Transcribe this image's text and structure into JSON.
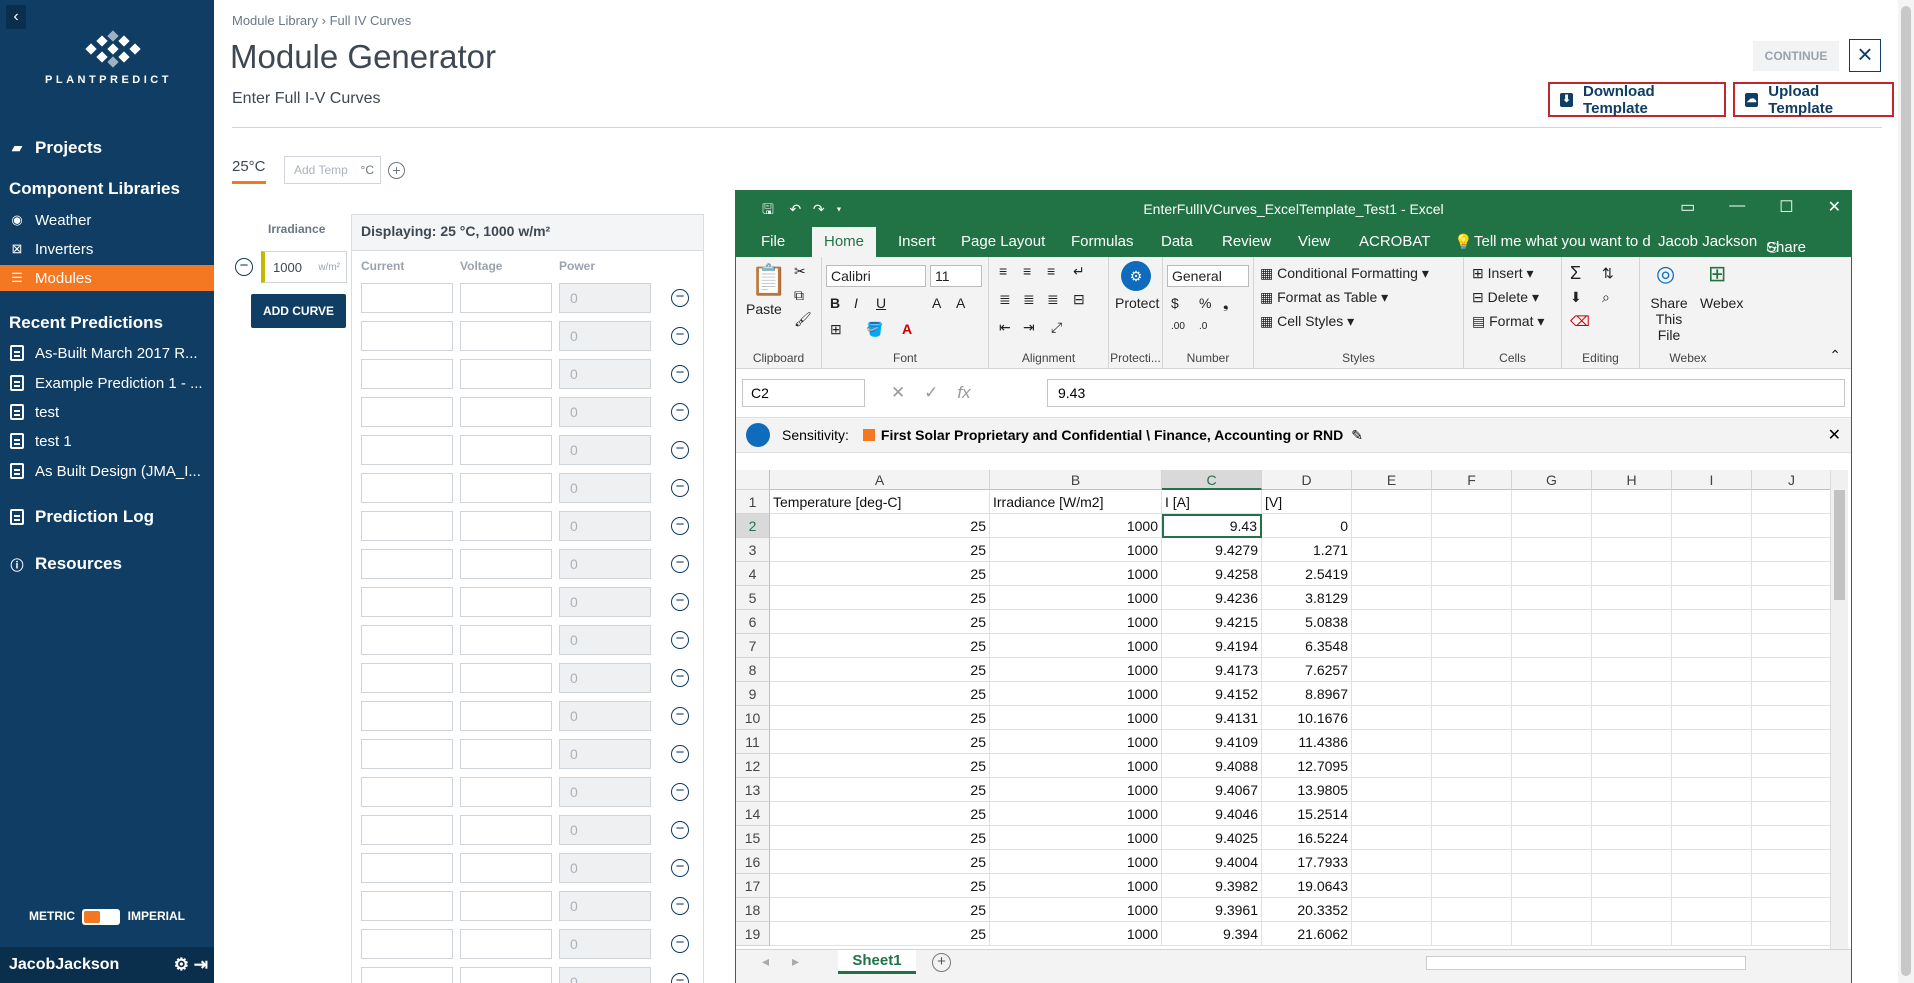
{
  "sidebar": {
    "logo_text": "PLANTPREDICT",
    "projects": "Projects",
    "component_libraries": "Component Libraries",
    "libraries": [
      {
        "label": "Weather",
        "icon": "weather-icon"
      },
      {
        "label": "Inverters",
        "icon": "inverter-icon"
      },
      {
        "label": "Modules",
        "icon": "modules-icon",
        "active": true
      }
    ],
    "recent_predictions_title": "Recent Predictions",
    "recent": [
      "As-Built March 2017 R...",
      "Example Prediction 1 - ...",
      "test",
      "test 1",
      "As Built Design (JMA_I..."
    ],
    "prediction_log": "Prediction Log",
    "resources": "Resources",
    "units": {
      "metric": "METRIC",
      "imperial": "IMPERIAL"
    },
    "user": "JacobJackson"
  },
  "header": {
    "breadcrumb": [
      "Module Library",
      "Full IV Curves"
    ],
    "title": "Module Generator",
    "subtitle": "Enter Full I-V Curves",
    "continue": "CONTINUE",
    "download": "Download Template",
    "upload": "Upload Template"
  },
  "temps": {
    "active_tab": "25°C",
    "add_placeholder": "Add Temp",
    "add_unit": "°C"
  },
  "irradiance": {
    "label": "Irradiance",
    "value": "1000",
    "unit": "w/m²",
    "add_curve": "ADD CURVE"
  },
  "curve": {
    "displaying": "Displaying: 25 °C, 1000 w/m²",
    "columns": [
      "Current",
      "Voltage",
      "Power"
    ],
    "power_placeholder": "0",
    "row_count": 19
  },
  "excel": {
    "title": "EnterFullIVCurves_ExcelTemplate_Test1 - Excel",
    "tabs": [
      "File",
      "Home",
      "Insert",
      "Page Layout",
      "Formulas",
      "Data",
      "Review",
      "View",
      "ACROBAT"
    ],
    "tell_me": "Tell me what you want to d",
    "user": "Jacob Jackson",
    "share": "Share",
    "ribbon": {
      "paste": "Paste",
      "clipboard": "Clipboard",
      "font_name": "Calibri",
      "font_size": "11",
      "font": "Font",
      "alignment": "Alignment",
      "protect": "Protect",
      "protection": "Protecti...",
      "number_format": "General",
      "number": "Number",
      "conditional": "Conditional Formatting",
      "format_table": "Format as Table",
      "cell_styles": "Cell Styles",
      "styles": "Styles",
      "insert": "Insert",
      "delete": "Delete",
      "format": "Format",
      "cells": "Cells",
      "editing": "Editing",
      "share_file": "Share This File",
      "webex": "Webex",
      "webex_group": "Webex"
    },
    "name_box": "C2",
    "formula": "9.43",
    "sensitivity_label": "Sensitivity:",
    "sensitivity_value": "First Solar Proprietary and Confidential \\ Finance, Accounting or RND",
    "columns": [
      "A",
      "B",
      "C",
      "D",
      "E",
      "F",
      "G",
      "H",
      "I",
      "J"
    ],
    "headers": [
      "Temperature [deg-C]",
      "Irradiance [W/m2]",
      "I [A]",
      "[V]"
    ],
    "rows": [
      [
        "25",
        "1000",
        "9.43",
        "0"
      ],
      [
        "25",
        "1000",
        "9.4279",
        "1.271"
      ],
      [
        "25",
        "1000",
        "9.4258",
        "2.5419"
      ],
      [
        "25",
        "1000",
        "9.4236",
        "3.8129"
      ],
      [
        "25",
        "1000",
        "9.4215",
        "5.0838"
      ],
      [
        "25",
        "1000",
        "9.4194",
        "6.3548"
      ],
      [
        "25",
        "1000",
        "9.4173",
        "7.6257"
      ],
      [
        "25",
        "1000",
        "9.4152",
        "8.8967"
      ],
      [
        "25",
        "1000",
        "9.4131",
        "10.1676"
      ],
      [
        "25",
        "1000",
        "9.4109",
        "11.4386"
      ],
      [
        "25",
        "1000",
        "9.4088",
        "12.7095"
      ],
      [
        "25",
        "1000",
        "9.4067",
        "13.9805"
      ],
      [
        "25",
        "1000",
        "9.4046",
        "15.2514"
      ],
      [
        "25",
        "1000",
        "9.4025",
        "16.5224"
      ],
      [
        "25",
        "1000",
        "9.4004",
        "17.7933"
      ],
      [
        "25",
        "1000",
        "9.3982",
        "19.0643"
      ],
      [
        "25",
        "1000",
        "9.3961",
        "20.3352"
      ],
      [
        "25",
        "1000",
        "9.394",
        "21.6062"
      ]
    ],
    "sheet": "Sheet1",
    "accent": "#217346"
  },
  "colors": {
    "sidebar": "#0f3d63",
    "accent": "#f47721",
    "highlight_border": "#c0272d"
  }
}
